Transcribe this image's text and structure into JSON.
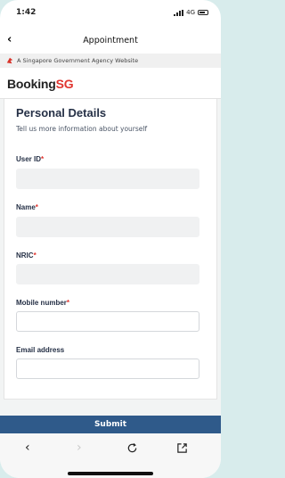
{
  "status": {
    "time": "1:42",
    "network": "4G"
  },
  "nav": {
    "title": "Appointment"
  },
  "gov_banner": {
    "text": "A Singapore Government Agency Website"
  },
  "header": {
    "logo_part1": "Booking",
    "logo_part2": "SG"
  },
  "form": {
    "title": "Personal Details",
    "subtitle": "Tell us more information about yourself",
    "fields": [
      {
        "label": "User ID",
        "required": "*",
        "value": ""
      },
      {
        "label": "Name",
        "required": "*",
        "value": ""
      },
      {
        "label": "NRIC",
        "required": "*",
        "value": ""
      },
      {
        "label": "Mobile number",
        "required": "*",
        "value": ""
      },
      {
        "label": "Email address",
        "required": "",
        "value": ""
      }
    ],
    "submit_label": "Submit"
  },
  "browser_bar": {
    "icons": [
      "chevron-left-icon",
      "chevron-right-icon",
      "reload-icon",
      "share-icon"
    ]
  },
  "colors": {
    "brand_red": "#e0352f",
    "submit_blue": "#2f5a8a",
    "title_navy": "#253046"
  }
}
